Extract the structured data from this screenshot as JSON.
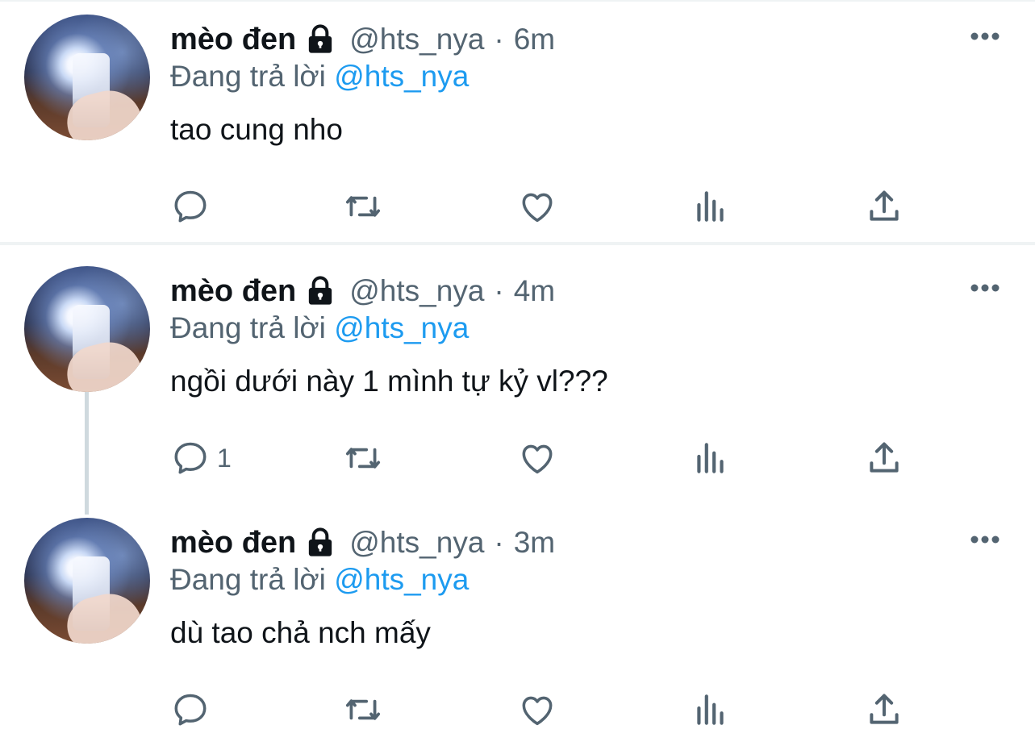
{
  "tweets": [
    {
      "name": "mèo đen",
      "handle": "@hts_nya",
      "separator": "·",
      "time": "6m",
      "replying_prefix": "Đang trả lời",
      "replying_to": "@hts_nya",
      "text": "tao cung nho",
      "reply_count": ""
    },
    {
      "name": "mèo đen",
      "handle": "@hts_nya",
      "separator": "·",
      "time": "4m",
      "replying_prefix": "Đang trả lời",
      "replying_to": "@hts_nya",
      "text": "ngồi dưới này 1 mình tự kỷ vl???",
      "reply_count": "1"
    },
    {
      "name": "mèo đen",
      "handle": "@hts_nya",
      "separator": "·",
      "time": "3m",
      "replying_prefix": "Đang trả lời",
      "replying_to": "@hts_nya",
      "text": "dù tao chả nch mấy",
      "reply_count": ""
    }
  ],
  "icons": {
    "protected": "lock-icon",
    "more": "more-icon",
    "reply": "reply-icon",
    "retweet": "retweet-icon",
    "like": "like-icon",
    "views": "views-icon",
    "share": "share-icon"
  },
  "colors": {
    "text": "#0f1419",
    "secondary": "#536471",
    "link": "#1d9bf0",
    "divider": "#eff3f4",
    "thread_line": "#cfd9de"
  }
}
